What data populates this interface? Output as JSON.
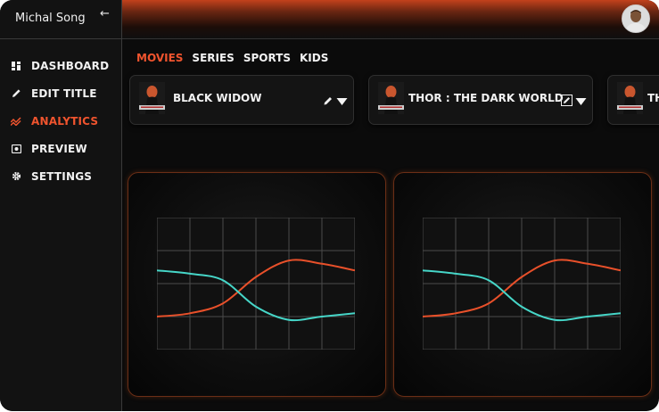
{
  "user": {
    "name": "Michal Song"
  },
  "sidebar": {
    "items": [
      {
        "label": "DASHBOARD",
        "icon": "dashboard-icon",
        "active": false
      },
      {
        "label": "EDIT TITLE",
        "icon": "pencil-icon",
        "active": false
      },
      {
        "label": "ANALYTICS",
        "icon": "analytics-icon",
        "active": true
      },
      {
        "label": "PREVIEW",
        "icon": "preview-icon",
        "active": false
      },
      {
        "label": "SETTINGS",
        "icon": "gear-icon",
        "active": false
      }
    ]
  },
  "tabs": [
    {
      "label": "MOVIES",
      "active": true
    },
    {
      "label": "SERIES",
      "active": false
    },
    {
      "label": "SPORTS",
      "active": false
    },
    {
      "label": "KIDS",
      "active": false
    }
  ],
  "titles": [
    {
      "name": "BLACK WIDOW",
      "poster_label": "BLACK WIDOW"
    },
    {
      "name": "THOR : THE DARK WORLD",
      "poster_label": "BLACK WIDOW"
    },
    {
      "name": "TH",
      "poster_label": "BLACK WIDOW"
    }
  ],
  "colors": {
    "accent": "#f0542e",
    "series_a": "#e8502a",
    "series_b": "#46d6c8"
  },
  "chart_data": [
    {
      "type": "line",
      "grid": true,
      "x": [
        0,
        1,
        2,
        3,
        4,
        5,
        6
      ],
      "xlim": [
        0,
        6
      ],
      "ylim": [
        0,
        4
      ],
      "series": [
        {
          "values": [
            1.0,
            1.1,
            1.4,
            2.2,
            2.7,
            2.6,
            2.4
          ]
        },
        {
          "values": [
            2.4,
            2.3,
            2.1,
            1.3,
            0.9,
            1.0,
            1.1
          ]
        }
      ]
    },
    {
      "type": "line",
      "grid": true,
      "x": [
        0,
        1,
        2,
        3,
        4,
        5,
        6
      ],
      "xlim": [
        0,
        6
      ],
      "ylim": [
        0,
        4
      ],
      "series": [
        {
          "values": [
            1.0,
            1.1,
            1.4,
            2.2,
            2.7,
            2.6,
            2.4
          ]
        },
        {
          "values": [
            2.4,
            2.3,
            2.1,
            1.3,
            0.9,
            1.0,
            1.1
          ]
        }
      ]
    }
  ]
}
